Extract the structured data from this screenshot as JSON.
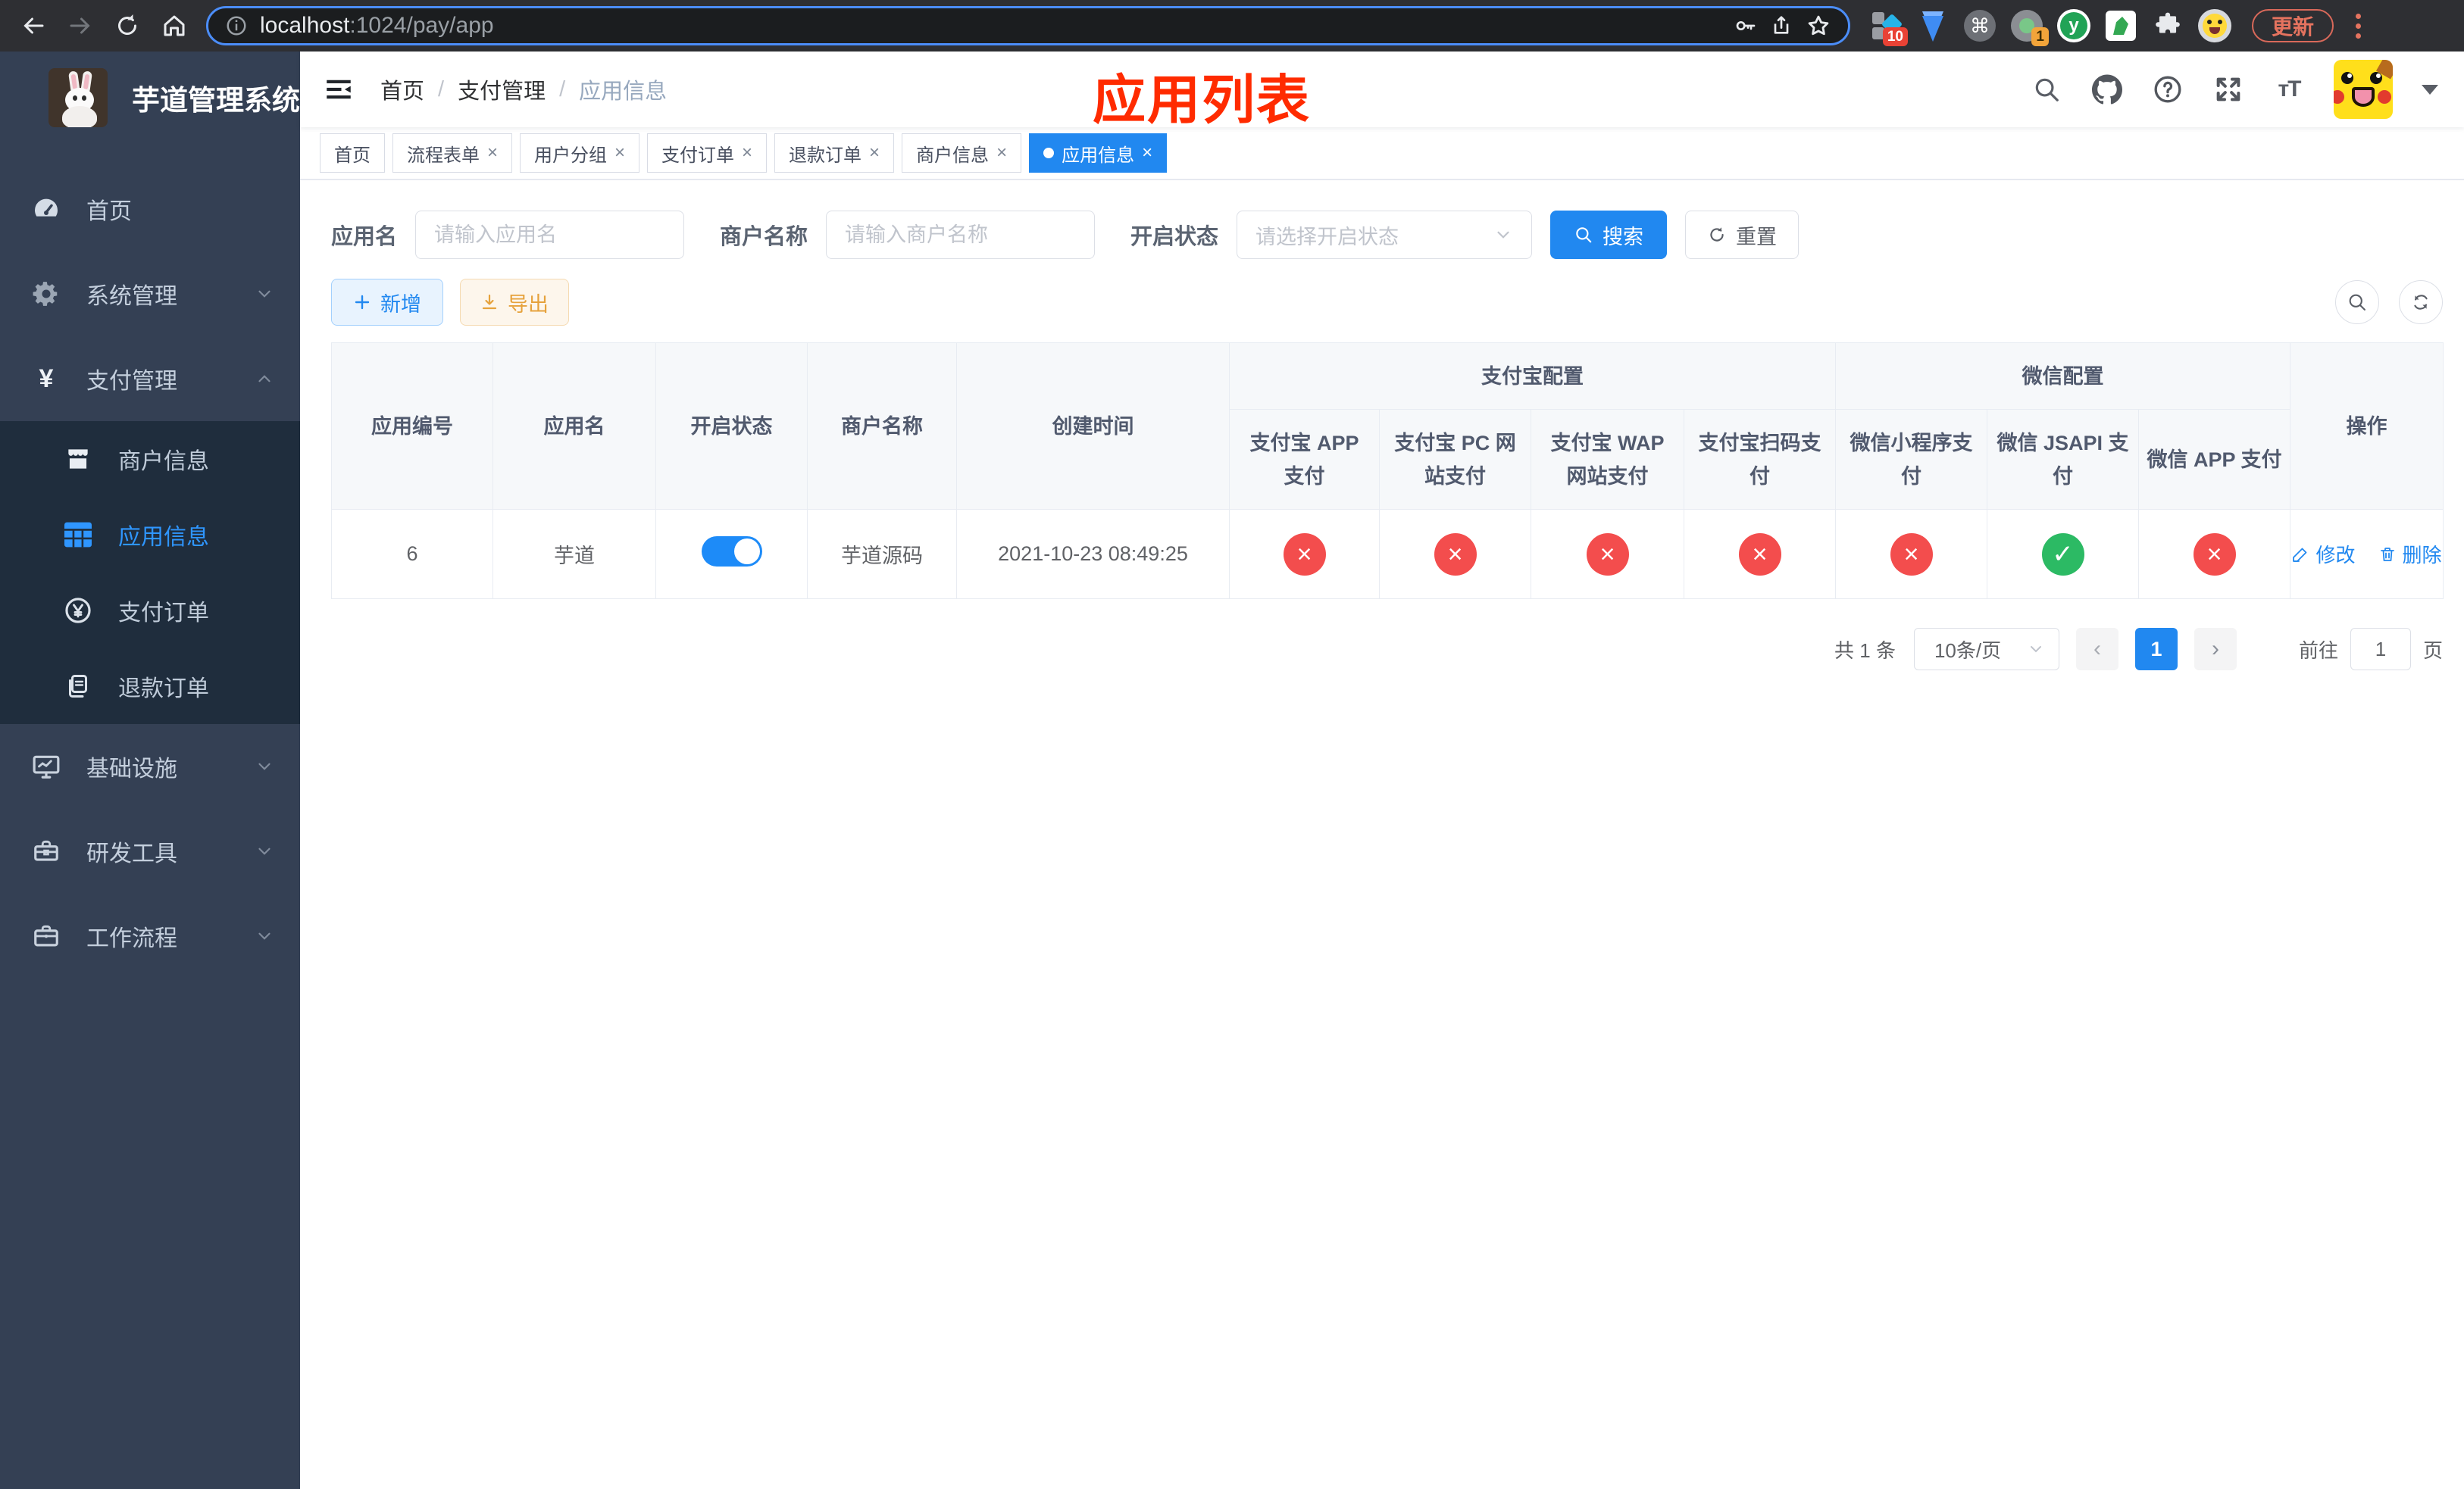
{
  "browser": {
    "url_host": "localhost",
    "url_rest": ":1024/pay/app",
    "update_label": "更新",
    "ext_badge_blue_diamond": "10",
    "ext_badge_gray_dot": "1",
    "ext_y_letter": "y"
  },
  "icons": {
    "close": "×",
    "check": "✓",
    "cross": "×",
    "cmd": "⌘",
    "chevron_left": "‹",
    "chevron_right": "›",
    "font_size": "тT"
  },
  "sidebar": {
    "title": "芋道管理系统",
    "items": [
      {
        "label": "首页"
      },
      {
        "label": "系统管理"
      },
      {
        "label": "支付管理",
        "children": [
          {
            "label": "商户信息"
          },
          {
            "label": "应用信息",
            "active": true
          },
          {
            "label": "支付订单"
          },
          {
            "label": "退款订单"
          }
        ]
      },
      {
        "label": "基础设施"
      },
      {
        "label": "研发工具"
      },
      {
        "label": "工作流程"
      }
    ]
  },
  "navbar": {
    "breadcrumb": [
      "首页",
      "支付管理",
      "应用信息"
    ],
    "separator": "/",
    "annotation": "应用列表"
  },
  "tabs": {
    "items": [
      {
        "label": "首页",
        "closable": false
      },
      {
        "label": "流程表单",
        "closable": true
      },
      {
        "label": "用户分组",
        "closable": true
      },
      {
        "label": "支付订单",
        "closable": true
      },
      {
        "label": "退款订单",
        "closable": true
      },
      {
        "label": "商户信息",
        "closable": true
      },
      {
        "label": "应用信息",
        "closable": true,
        "active": true
      }
    ]
  },
  "filters": {
    "app_name_label": "应用名",
    "app_name_placeholder": "请输入应用名",
    "merchant_label": "商户名称",
    "merchant_placeholder": "请输入商户名称",
    "status_label": "开启状态",
    "status_placeholder": "请选择开启状态",
    "search_label": "搜索",
    "reset_label": "重置"
  },
  "toolbar": {
    "add_label": "新增",
    "export_label": "导出"
  },
  "table": {
    "columns": [
      "应用编号",
      "应用名",
      "开启状态",
      "商户名称",
      "创建时间"
    ],
    "groups": [
      "支付宝配置",
      "微信配置"
    ],
    "sub_columns": [
      "支付宝 APP 支付",
      "支付宝 PC 网站支付",
      "支付宝 WAP 网站支付",
      "支付宝扫码支付",
      "微信小程序支付",
      "微信 JSAPI 支付",
      "微信 APP 支付"
    ],
    "actions_column": "操作",
    "row": {
      "id": "6",
      "name": "芋道",
      "enabled": true,
      "merchant": "芋道源码",
      "created_at": "2021-10-23 08:49:25",
      "pay_statuses": [
        false,
        false,
        false,
        false,
        false,
        true,
        false
      ],
      "edit_label": "修改",
      "delete_label": "删除"
    }
  },
  "pagination": {
    "total": "共 1 条",
    "page_size": "10条/页",
    "current": "1",
    "goto_prefix": "前往",
    "goto_value": "1",
    "goto_suffix": "页"
  },
  "colors": {
    "accent": "#2188f0",
    "success": "#2cba64",
    "danger": "#f34d4d",
    "warning": "#e6a23c",
    "sidebar_bg": "#344054",
    "submenu_bg": "#1f2d3d",
    "annotation": "#ff2b00"
  }
}
